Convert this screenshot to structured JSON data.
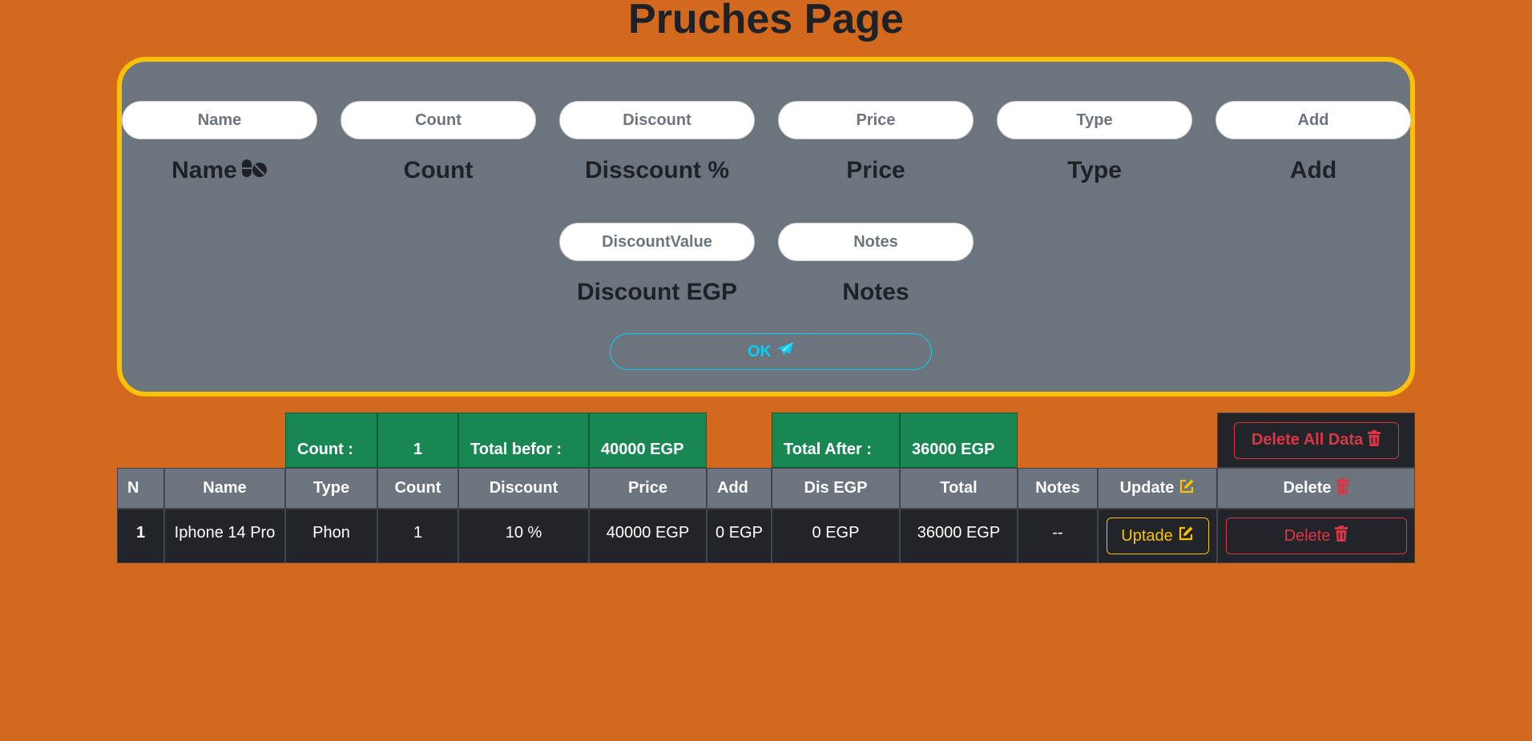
{
  "page": {
    "title": "Pruches Page"
  },
  "form": {
    "fields": [
      {
        "placeholder": "Name",
        "label": "Name"
      },
      {
        "placeholder": "Count",
        "label": "Count"
      },
      {
        "placeholder": "Discount",
        "label": "Disscount %"
      },
      {
        "placeholder": "Price",
        "label": "Price"
      },
      {
        "placeholder": "Type",
        "label": "Type"
      },
      {
        "placeholder": "Add",
        "label": "Add"
      },
      {
        "placeholder": "DiscountValue",
        "label": "Discount EGP"
      },
      {
        "placeholder": "Notes",
        "label": "Notes"
      }
    ],
    "ok_label": "OK"
  },
  "summary": {
    "count_label": "Count :",
    "count_value": "1",
    "total_before_label": "Total befor :",
    "total_before_value": "40000 EGP",
    "total_after_label": "Total After :",
    "total_after_value": "36000 EGP",
    "delete_all_label": "Delete All Data"
  },
  "table": {
    "headers": [
      "N",
      "Name",
      "Type",
      "Count",
      "Discount",
      "Price",
      "Add",
      "Dis EGP",
      "Total",
      "Notes",
      "Update",
      "Delete"
    ],
    "rows": [
      {
        "n": "1",
        "name": "Iphone 14 Pro",
        "type": "Phon",
        "count": "1",
        "discount": "10 %",
        "price": "40000 EGP",
        "add": "0 EGP",
        "dis_egp": "0 EGP",
        "total": "36000 EGP",
        "notes": "--",
        "update_label": "Uptade",
        "delete_label": "Delete"
      }
    ]
  },
  "colors": {
    "background": "#d2691e",
    "card_border": "#ffc107",
    "card_bg": "#6c757d",
    "summary_green": "#198754",
    "table_dark": "#212529",
    "ok_info": "#0dcaf0",
    "warning": "#ffc107",
    "danger": "#dc3545"
  }
}
